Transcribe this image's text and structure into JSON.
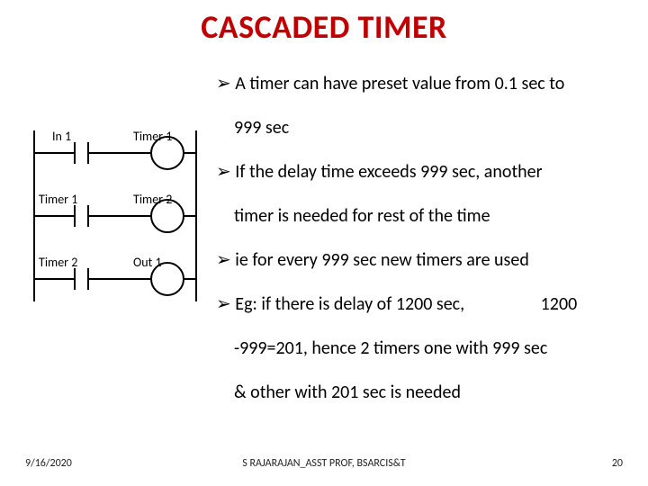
{
  "title": "CASCADED TIMER",
  "bullets": {
    "b1a": "A timer can have preset value from 0.1 sec to",
    "b1b": "999 sec",
    "b2a": "If the delay time exceeds 999 sec, another",
    "b2b": "timer is needed for rest of the time",
    "b3": "ie for every 999 sec new timers are used",
    "b4a": "Eg: if there is delay of 1200 sec,",
    "b4a_tail": "1200",
    "b4b": "-999=201, hence 2 timers one with 999 sec",
    "b4c": "& other with 201 sec is needed"
  },
  "arrow_glyph": "➢",
  "diagram": {
    "labels": {
      "in1": "In 1",
      "timer1_right": "Timer 1",
      "timer1_left": "Timer 1",
      "timer2_right": "Timer 2",
      "timer2_left": "Timer 2",
      "out1": "Out 1"
    }
  },
  "footer": {
    "date": "9/16/2020",
    "center": "S RAJARAJAN_ASST PROF, BSARCIS&T",
    "page": "20"
  }
}
